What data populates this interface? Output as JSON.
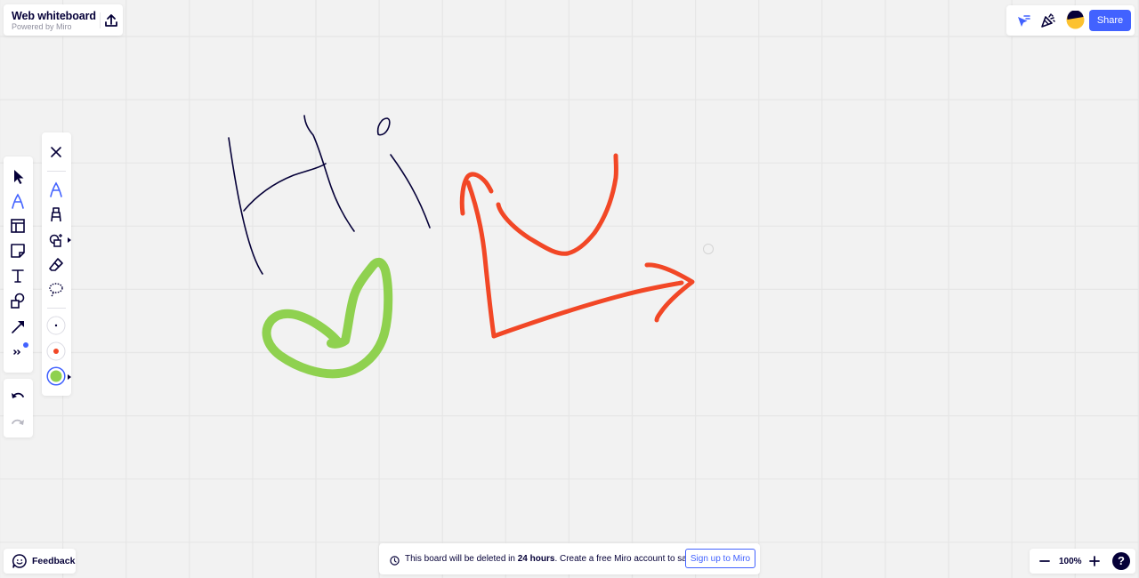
{
  "header": {
    "title": "Web whiteboard",
    "subtitle": "Powered by Miro",
    "export_icon": "upload-icon"
  },
  "top_right": {
    "icons": [
      "cursor-follow-icon",
      "celebrate-icon",
      "avatar"
    ],
    "share_label": "Share"
  },
  "main_toolbar": {
    "tools": [
      {
        "name": "select",
        "icon": "cursor-arrow-icon",
        "active": false
      },
      {
        "name": "pen",
        "icon": "pen-icon",
        "active": true
      },
      {
        "name": "templates",
        "icon": "template-icon",
        "active": false
      },
      {
        "name": "sticky-note",
        "icon": "sticky-note-icon",
        "active": false
      },
      {
        "name": "text",
        "icon": "text-icon",
        "active": false
      },
      {
        "name": "shapes",
        "icon": "shapes-icon",
        "active": false
      },
      {
        "name": "connection-line",
        "icon": "arrow-line-icon",
        "active": false
      },
      {
        "name": "more",
        "icon": "chevron-double-right-icon",
        "active": false
      }
    ],
    "history": [
      {
        "name": "undo",
        "icon": "undo-icon",
        "enabled": true
      },
      {
        "name": "redo",
        "icon": "redo-icon",
        "enabled": false
      }
    ]
  },
  "pen_toolbar": {
    "close_icon": "close-icon",
    "tools": [
      {
        "name": "pen",
        "icon": "pen-icon",
        "active": true
      },
      {
        "name": "marker",
        "icon": "marker-icon",
        "active": false
      },
      {
        "name": "smart-drawing",
        "icon": "smart-shapes-icon",
        "active": false
      },
      {
        "name": "eraser",
        "icon": "eraser-icon",
        "active": false
      },
      {
        "name": "lasso",
        "icon": "lasso-icon",
        "active": false
      }
    ],
    "colors": [
      {
        "name": "black",
        "hex": "#050038",
        "size": "thin",
        "selected": false
      },
      {
        "name": "red",
        "hex": "#f24726",
        "size": "medium",
        "selected": false
      },
      {
        "name": "green",
        "hex": "#8fd14f",
        "size": "thick",
        "selected": true
      }
    ]
  },
  "canvas": {
    "background": "#f2f2f2",
    "grid_color": "#e6e6e6",
    "strokes": [
      {
        "id": "h-left",
        "color": "#050038",
        "width": "thin"
      },
      {
        "id": "h-right",
        "color": "#050038",
        "width": "thin"
      },
      {
        "id": "h-bar",
        "color": "#050038",
        "width": "thin"
      },
      {
        "id": "i-dot",
        "color": "#050038",
        "width": "thin"
      },
      {
        "id": "i-stem",
        "color": "#050038",
        "width": "thin"
      },
      {
        "id": "green-loop",
        "color": "#8fd14f",
        "width": "thick"
      },
      {
        "id": "red-up-arrow",
        "color": "#f24726",
        "width": "medium"
      },
      {
        "id": "red-arrowhead-up",
        "color": "#f24726",
        "width": "medium"
      },
      {
        "id": "red-smile",
        "color": "#f24726",
        "width": "medium"
      },
      {
        "id": "red-right-arrow",
        "color": "#f24726",
        "width": "medium"
      },
      {
        "id": "red-arrowhead-right",
        "color": "#f24726",
        "width": "medium"
      }
    ]
  },
  "notice": {
    "icon": "clock-icon",
    "text_before": "This board will be deleted in ",
    "text_bold": "24 hours",
    "text_after": ". Create a free Miro account to save it.",
    "signup_label": "Sign up to Miro"
  },
  "feedback": {
    "icon": "smiley-chat-icon",
    "label": "Feedback"
  },
  "zoom": {
    "level": "100%",
    "zoom_out_icon": "minus-icon",
    "zoom_in_icon": "plus-icon",
    "help_label": "?"
  }
}
